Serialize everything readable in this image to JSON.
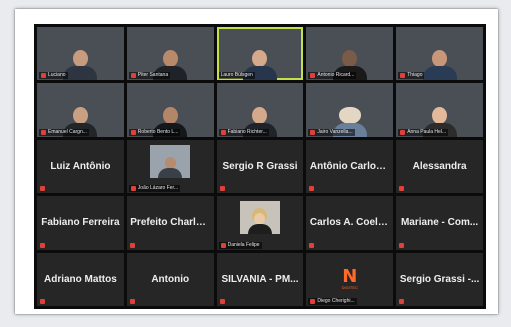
{
  "participants": [
    {
      "name": "Luciano",
      "kind": "video"
    },
    {
      "name": "Piter Santana",
      "kind": "video"
    },
    {
      "name": "Lauro Bülsgen",
      "kind": "video",
      "active": true
    },
    {
      "name": "Antonio Ricard...",
      "kind": "video"
    },
    {
      "name": "Thiago",
      "kind": "video"
    },
    {
      "name": "Emanuel Cargn...",
      "kind": "video"
    },
    {
      "name": "Roberto Bento L...",
      "kind": "video"
    },
    {
      "name": "Fabiano Richter...",
      "kind": "video"
    },
    {
      "name": "Jairo Vanzella...",
      "kind": "video"
    },
    {
      "name": "Anna Paula Hel...",
      "kind": "video"
    },
    {
      "name": "Luiz Antônio",
      "kind": "name"
    },
    {
      "name": "João Lázaro Fer...",
      "kind": "thumb"
    },
    {
      "name": "Sergio R Grassi",
      "kind": "name"
    },
    {
      "name": "Antônio Carlos...",
      "kind": "name"
    },
    {
      "name": "Alessandra",
      "kind": "name"
    },
    {
      "name": "Fabiano Ferreira",
      "kind": "name"
    },
    {
      "name": "Prefeito Charles...",
      "kind": "name"
    },
    {
      "name": "Daniela Felipe",
      "kind": "thumb"
    },
    {
      "name": "Carlos A. Coelh...",
      "kind": "name"
    },
    {
      "name": "Mariane - Com...",
      "kind": "name"
    },
    {
      "name": "Adriano Mattos",
      "kind": "name"
    },
    {
      "name": "Antonio",
      "kind": "name"
    },
    {
      "name": "SILVANIA - PM...",
      "kind": "name"
    },
    {
      "name": "Diego Cherighi...",
      "kind": "logo",
      "logo_text": "N",
      "logo_caption": "DIGITEC"
    },
    {
      "name": "Sergio Grassi -...",
      "kind": "name"
    }
  ],
  "colors": {
    "mic_muted": "#e0403a",
    "active_speaker": "#c6e04a",
    "tile_bg": "#262626"
  }
}
